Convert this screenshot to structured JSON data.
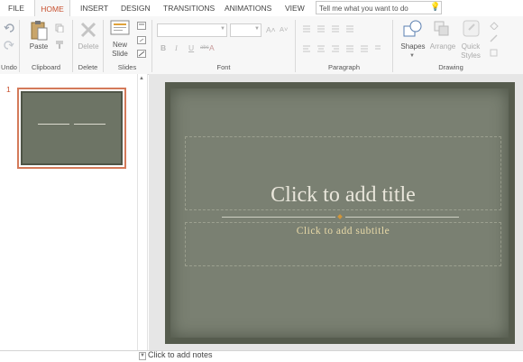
{
  "tabs": [
    "FILE",
    "HOME",
    "INSERT",
    "DESIGN",
    "TRANSITIONS",
    "ANIMATIONS",
    "VIEW"
  ],
  "active_tab": "HOME",
  "tell_me": "Tell me what you want to do",
  "ribbon": {
    "groups": {
      "undo": "Undo",
      "clipboard": "Clipboard",
      "delete": "Delete",
      "slides": "Slides",
      "font": "Font",
      "paragraph": "Paragraph",
      "drawing": "Drawing"
    },
    "buttons": {
      "paste": "Paste",
      "delete": "Delete",
      "new_slide_1": "New",
      "new_slide_2": "Slide",
      "shapes": "Shapes",
      "arrange": "Arrange",
      "quick_styles_1": "Quick",
      "quick_styles_2": "Styles"
    },
    "font_buttons": [
      "B",
      "I",
      "U",
      "abc",
      "A"
    ]
  },
  "slide_pane": {
    "slide_number": "1"
  },
  "slide": {
    "title_placeholder": "Click to add title",
    "subtitle_placeholder": "Click to add subtitle"
  },
  "notes": {
    "placeholder": "Click to add notes"
  },
  "colors": {
    "accent": "#c8502e",
    "slide_bg": "#7a8072",
    "subtitle": "#e8d9a7"
  }
}
